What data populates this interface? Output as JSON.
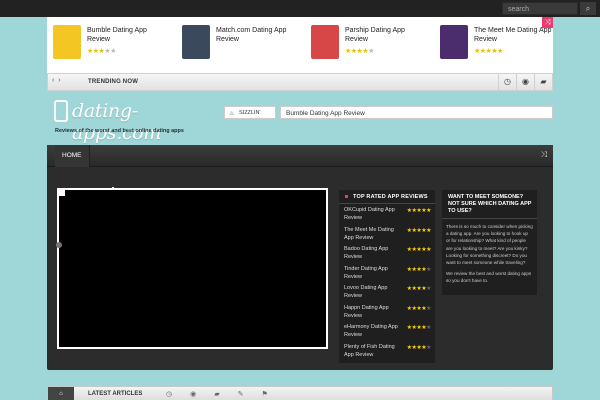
{
  "search": {
    "placeholder": "search"
  },
  "featured": [
    {
      "title": "Bumble Dating App Review",
      "stars": 3,
      "thumb_color": "#f3c623"
    },
    {
      "title": "Match.com Dating App Review",
      "stars": 0,
      "thumb_color": "#3a4a5c"
    },
    {
      "title": "Parship Dating App Review",
      "stars": 4,
      "thumb_color": "#d84747"
    },
    {
      "title": "The Meet Me Dating App Review",
      "stars": 5,
      "thumb_color": "#4b2d6e"
    }
  ],
  "trending": {
    "label": "TRENDING NOW"
  },
  "site": {
    "logo": "dating-apps.com",
    "tagline": "Reviews of the worst and best online dating apps"
  },
  "sizzlin": {
    "label": "SIZZLIN'",
    "post": "Bumble Dating App Review"
  },
  "nav": {
    "home": "HOME"
  },
  "top_rated": {
    "title": "TOP RATED APP REVIEWS",
    "items": [
      {
        "name": "OKCupid Dating App Review",
        "stars": 5
      },
      {
        "name": "The Meet Me Dating App Review",
        "stars": 5
      },
      {
        "name": "Badoo Dating App Review",
        "stars": 4.5
      },
      {
        "name": "Tinder Dating App Review",
        "stars": 4
      },
      {
        "name": "Lovoo Dating App Review",
        "stars": 4
      },
      {
        "name": "Happn Dating App Review",
        "stars": 4
      },
      {
        "name": "eHarmony Dating App Review",
        "stars": 4
      },
      {
        "name": "Plenty of Fish Dating App Review",
        "stars": 3.5
      }
    ]
  },
  "want": {
    "title": "WANT TO MEET SOMEONE? NOT SURE WHICH DATING APP TO USE?",
    "para1": "There is so much to consider when picking a dating app. Are you looking to hook up or for relationship? What kind of people are you looking to meet? Are you kinky? Looking for something discreet? Do you want to meet someone while traveling?",
    "para2": "We review the best and worst dating apps so you don't have to."
  },
  "latest": {
    "label": "LATEST ARTICLES"
  }
}
